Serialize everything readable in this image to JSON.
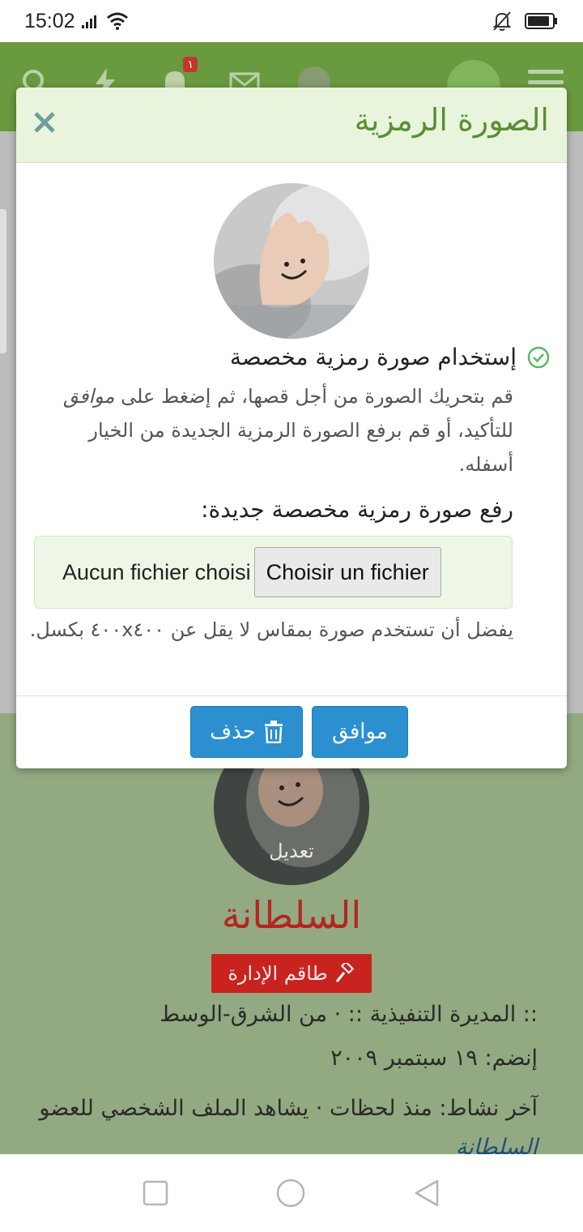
{
  "status_bar": {
    "time": "15:02",
    "icons": [
      "signal-icon",
      "wifi-icon",
      "bell-off-icon",
      "battery-icon"
    ]
  },
  "header": {
    "notification_count": "١",
    "icons": [
      "search-icon",
      "lightning-icon",
      "bell-icon",
      "mail-icon",
      "avatar",
      "logo",
      "menu-icon"
    ]
  },
  "modal": {
    "title": "الصورة الرمزية",
    "use_custom_label": "إستخدام صورة رمزية مخصصة",
    "help_part1": "قم بتحريك الصورة من أجل قصها، ثم إضغط على",
    "help_ok_word": "موافق",
    "help_part2": "للتأكيد، أو قم برفع الصورة الرمزية الجديدة من الخيار أسفله.",
    "upload_label": "رفع صورة رمزية مخصصة جديدة:",
    "file_button": "Choisir un fichier",
    "file_status": "Aucun fichier choisi",
    "size_hint": "يفضل أن تستخدم صورة بمقاس لا يقل عن ٤٠٠x٤٠٠ بكسل.",
    "ok_button": "موافق",
    "delete_button": "حذف"
  },
  "profile": {
    "edit_label": "تعديل",
    "name": "السلطانة",
    "staff_badge": "طاقم الإدارة",
    "role_line": ":: المديرة التنفيذية :: · من الشرق-الوسط",
    "joined_line": "إنضم: ١٩ سبتمبر ٢٠٠٩",
    "activity_line": "آخر نشاط: منذ لحظات · يشاهد الملف الشخصي للعضو",
    "activity_link": "السلطانة"
  },
  "colors": {
    "header_green": "#6a9a3f",
    "modal_header_bg": "#e8f5dc",
    "title_green": "#5b8e35",
    "button_blue": "#2b8fd0",
    "name_red": "#b3261e",
    "badge_red": "#c9231f"
  }
}
